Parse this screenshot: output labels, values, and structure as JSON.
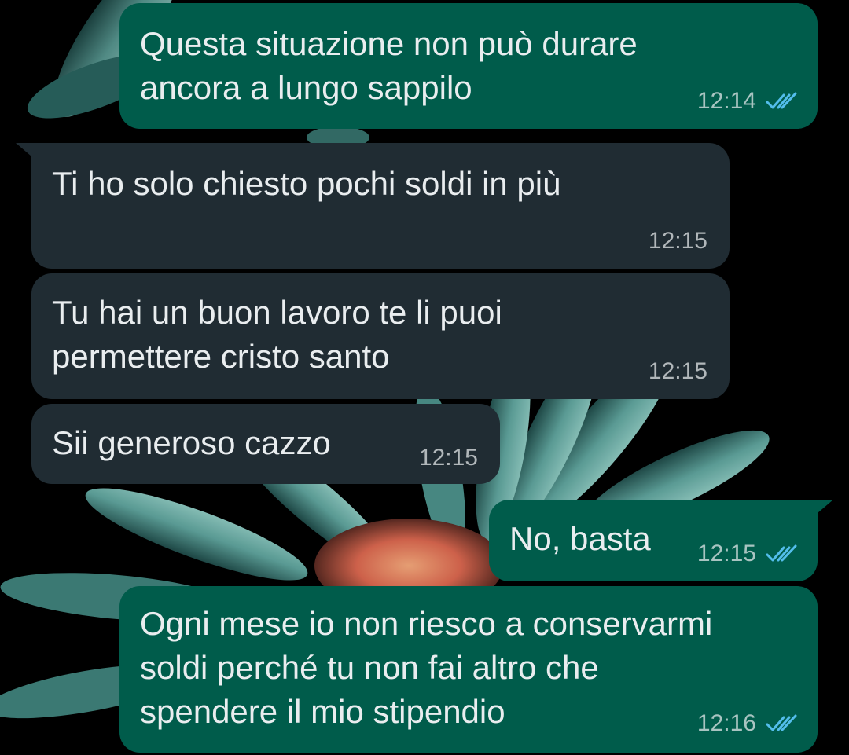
{
  "theme": {
    "outgoing_bubble": "#005c4b",
    "incoming_bubble": "#202c33",
    "text": "#e9edef",
    "read_ticks": "#53bdeb",
    "wallpaper": "dark flower (teal petals, orange center)"
  },
  "messages": [
    {
      "direction": "outgoing",
      "text": "Questa situazione non può durare\nancora a lungo sappilo",
      "time": "12:14",
      "status": "read"
    },
    {
      "direction": "incoming",
      "text": "Ti ho solo chiesto pochi soldi in più",
      "time": "12:15"
    },
    {
      "direction": "incoming",
      "text": "Tu hai un buon lavoro te li puoi\npermettere cristo santo",
      "time": "12:15"
    },
    {
      "direction": "incoming",
      "text": "Sii generoso cazzo",
      "time": "12:15"
    },
    {
      "direction": "outgoing",
      "text": "No, basta",
      "time": "12:15",
      "status": "read"
    },
    {
      "direction": "outgoing",
      "text": "Ogni mese io non riesco a conservarmi\nsoldi perché tu non fai altro che\nspendere il mio stipendio",
      "time": "12:16",
      "status": "read"
    }
  ]
}
